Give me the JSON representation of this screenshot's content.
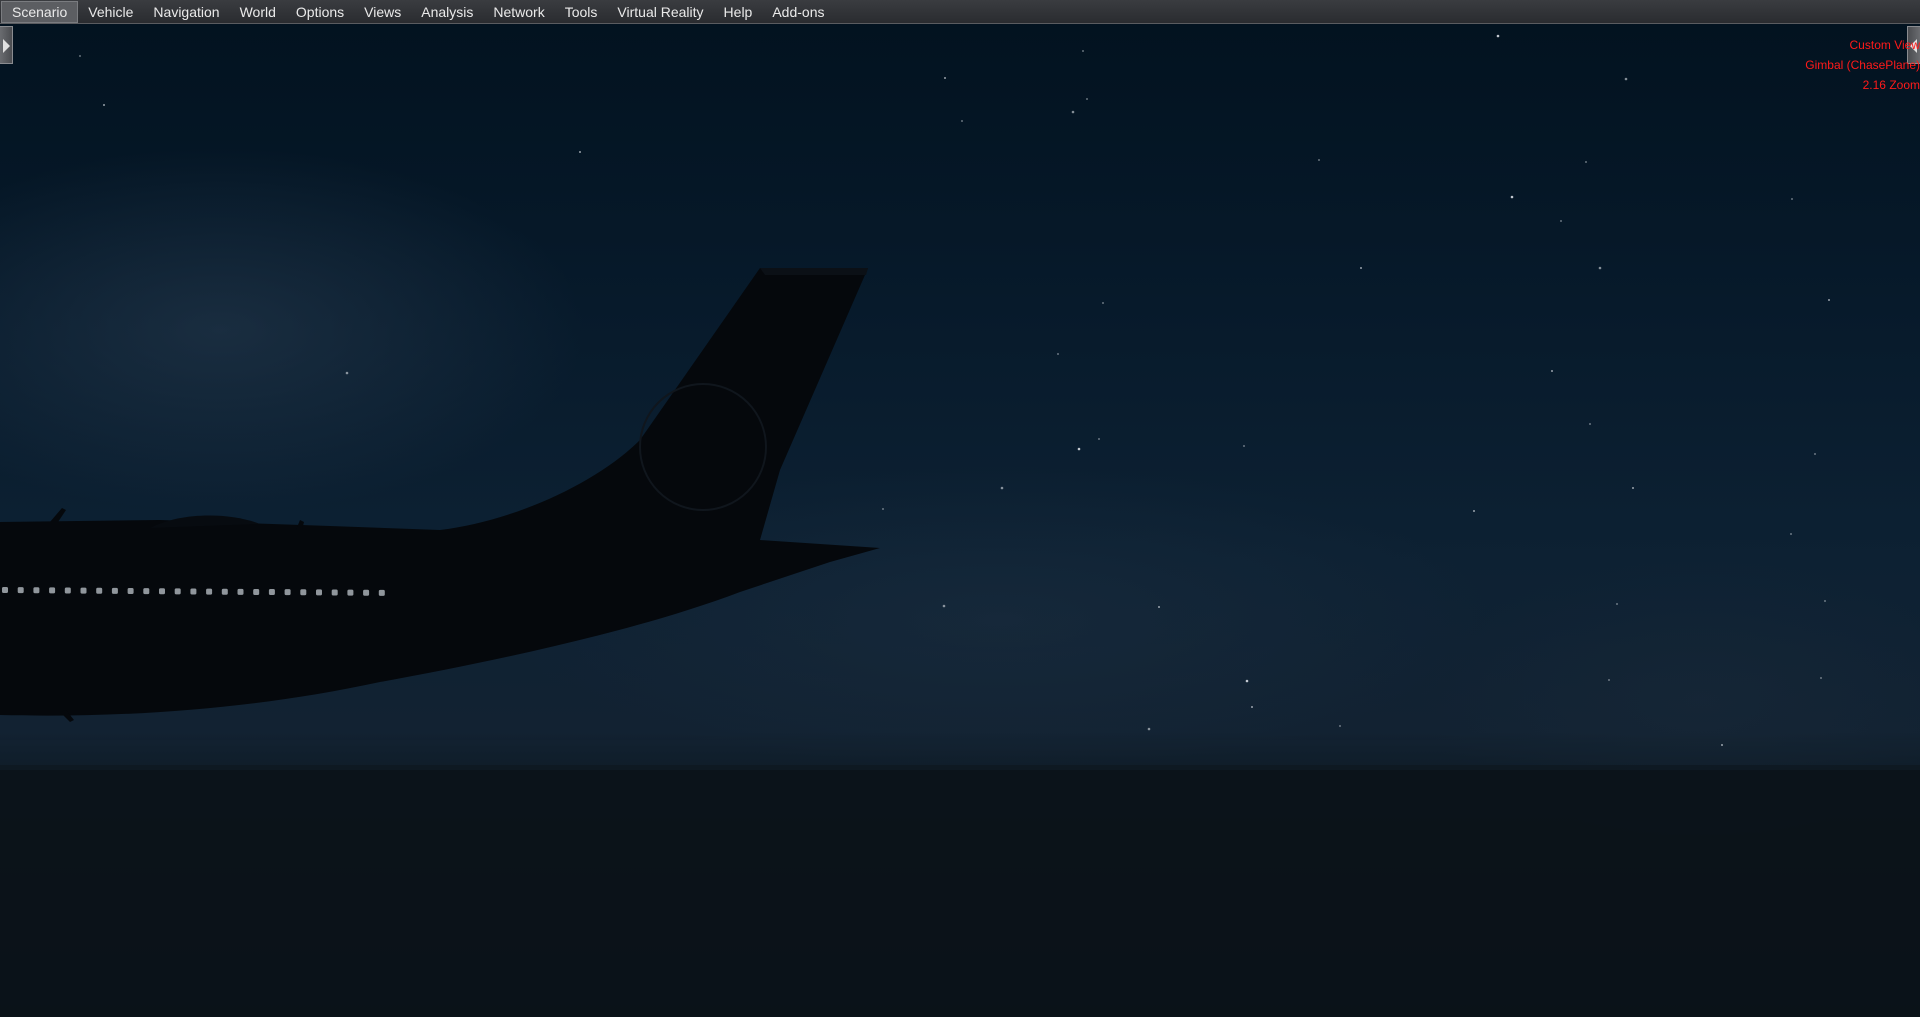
{
  "menubar": {
    "items": [
      {
        "label": "Scenario",
        "active": true
      },
      {
        "label": "Vehicle"
      },
      {
        "label": "Navigation"
      },
      {
        "label": "World"
      },
      {
        "label": "Options"
      },
      {
        "label": "Views"
      },
      {
        "label": "Analysis"
      },
      {
        "label": "Network"
      },
      {
        "label": "Tools"
      },
      {
        "label": "Virtual Reality"
      },
      {
        "label": "Help"
      },
      {
        "label": "Add-ons"
      }
    ]
  },
  "view_info": {
    "view_name": "Custom View",
    "camera_mode": "Gimbal (ChasePlane)",
    "zoom": "2.16 Zoom",
    "color": "#ff1a1a"
  },
  "handles": {
    "left_icon": "expand-right-arrow-icon",
    "right_icon": "expand-left-arrow-icon"
  }
}
